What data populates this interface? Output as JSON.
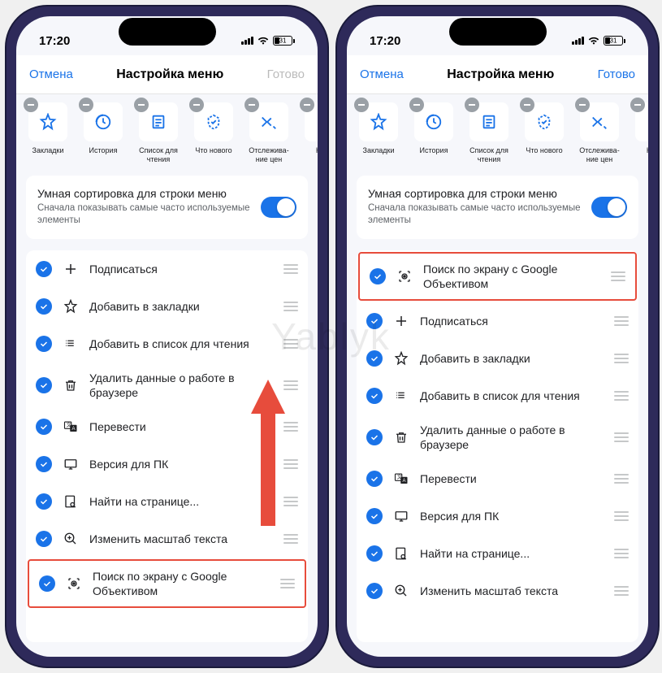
{
  "status": {
    "time": "17:20",
    "battery": "31"
  },
  "nav": {
    "cancel": "Отмена",
    "title": "Настройка меню",
    "done": "Готово"
  },
  "shortcuts": [
    {
      "label": "Закладки"
    },
    {
      "label": "История"
    },
    {
      "label": "Список для чтения"
    },
    {
      "label": "Что нового"
    },
    {
      "label": "Отслежива-ние цен"
    },
    {
      "label": "Наст"
    }
  ],
  "smart": {
    "title": "Умная сортировка для строки меню",
    "sub": "Сначала показывать самые часто используемые элементы"
  },
  "left_items": [
    {
      "icon": "plus",
      "label": "Подписаться"
    },
    {
      "icon": "star",
      "label": "Добавить в закладки"
    },
    {
      "icon": "readlist",
      "label": "Добавить в список для чтения"
    },
    {
      "icon": "trash",
      "label": "Удалить данные о работе в браузере"
    },
    {
      "icon": "translate",
      "label": "Перевести"
    },
    {
      "icon": "desktop",
      "label": "Версия для ПК"
    },
    {
      "icon": "find",
      "label": "Найти на странице..."
    },
    {
      "icon": "zoom",
      "label": "Изменить масштаб текста"
    },
    {
      "icon": "lens",
      "label": "Поиск по экрану с Google Объективом",
      "hl": true
    }
  ],
  "right_items": [
    {
      "icon": "lens",
      "label": "Поиск по экрану с Google Объективом",
      "hl": true
    },
    {
      "icon": "plus",
      "label": "Подписаться"
    },
    {
      "icon": "star",
      "label": "Добавить в закладки"
    },
    {
      "icon": "readlist",
      "label": "Добавить в список для чтения"
    },
    {
      "icon": "trash",
      "label": "Удалить данные о работе в браузере"
    },
    {
      "icon": "translate",
      "label": "Перевести"
    },
    {
      "icon": "desktop",
      "label": "Версия для ПК"
    },
    {
      "icon": "find",
      "label": "Найти на странице..."
    },
    {
      "icon": "zoom",
      "label": "Изменить масштаб текста"
    }
  ],
  "watermark": "Yablyk"
}
